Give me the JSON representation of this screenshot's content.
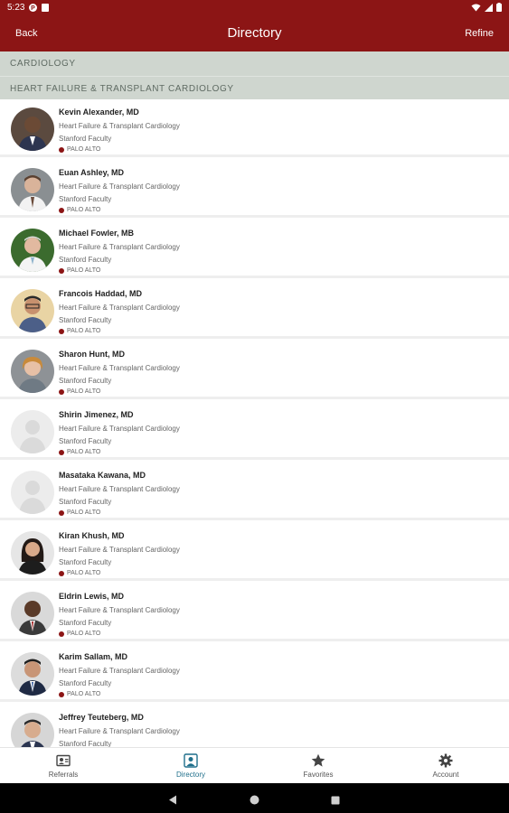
{
  "status_bar": {
    "time": "5:23",
    "icons": [
      "notification-p-icon",
      "notification-doc-icon",
      "wifi-icon",
      "signal-icon",
      "battery-icon"
    ]
  },
  "app_bar": {
    "back_label": "Back",
    "title": "Directory",
    "refine_label": "Refine"
  },
  "sections": {
    "primary": "CARDIOLOGY",
    "secondary": "HEART FAILURE & TRANSPLANT CARDIOLOGY"
  },
  "doctors": [
    {
      "name": "Kevin Alexander, MD",
      "specialty": "Heart Failure & Transplant Cardiology",
      "affiliation": "Stanford Faculty",
      "location": "PALO ALTO",
      "avatar": "photo"
    },
    {
      "name": "Euan Ashley, MD",
      "specialty": "Heart Failure & Transplant Cardiology",
      "affiliation": "Stanford Faculty",
      "location": "PALO ALTO",
      "avatar": "photo"
    },
    {
      "name": "Michael Fowler, MB",
      "specialty": "Heart Failure & Transplant Cardiology",
      "affiliation": "Stanford Faculty",
      "location": "PALO ALTO",
      "avatar": "photo"
    },
    {
      "name": "Francois Haddad, MD",
      "specialty": "Heart Failure & Transplant Cardiology",
      "affiliation": "Stanford Faculty",
      "location": "PALO ALTO",
      "avatar": "photo"
    },
    {
      "name": "Sharon Hunt, MD",
      "specialty": "Heart Failure & Transplant Cardiology",
      "affiliation": "Stanford Faculty",
      "location": "PALO ALTO",
      "avatar": "photo"
    },
    {
      "name": "Shirin Jimenez, MD",
      "specialty": "Heart Failure & Transplant Cardiology",
      "affiliation": "Stanford Faculty",
      "location": "PALO ALTO",
      "avatar": "placeholder"
    },
    {
      "name": "Masataka Kawana, MD",
      "specialty": "Heart Failure & Transplant Cardiology",
      "affiliation": "Stanford Faculty",
      "location": "PALO ALTO",
      "avatar": "placeholder"
    },
    {
      "name": "Kiran Khush, MD",
      "specialty": "Heart Failure & Transplant Cardiology",
      "affiliation": "Stanford Faculty",
      "location": "PALO ALTO",
      "avatar": "photo"
    },
    {
      "name": "Eldrin Lewis, MD",
      "specialty": "Heart Failure & Transplant Cardiology",
      "affiliation": "Stanford Faculty",
      "location": "PALO ALTO",
      "avatar": "photo"
    },
    {
      "name": "Karim Sallam, MD",
      "specialty": "Heart Failure & Transplant Cardiology",
      "affiliation": "Stanford Faculty",
      "location": "PALO ALTO",
      "avatar": "photo"
    },
    {
      "name": "Jeffrey Teuteberg, MD",
      "specialty": "Heart Failure & Transplant Cardiology",
      "affiliation": "Stanford Faculty",
      "location": "",
      "avatar": "photo"
    }
  ],
  "bottom_nav": [
    {
      "label": "Referrals",
      "icon": "referral-card-icon",
      "active": false
    },
    {
      "label": "Directory",
      "icon": "directory-person-icon",
      "active": true
    },
    {
      "label": "Favorites",
      "icon": "star-icon",
      "active": false
    },
    {
      "label": "Account",
      "icon": "gear-icon",
      "active": false
    }
  ],
  "colors": {
    "brand": "#8c1515",
    "section_bg": "#cfd6cf",
    "active_tab": "#1f6f8b"
  }
}
